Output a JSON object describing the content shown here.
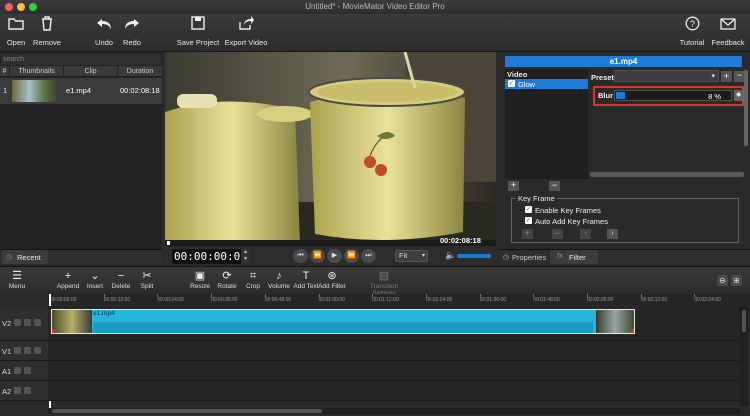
{
  "window": {
    "title": "Untitled* - MovieMator Video Editor Pro"
  },
  "toolbar": {
    "open": "Open",
    "remove": "Remove",
    "undo": "Undo",
    "redo": "Redo",
    "save_project": "Save Project",
    "export_video": "Export Video",
    "tutorial": "Tutorial",
    "feedback": "Feedback"
  },
  "media": {
    "search_placeholder": "search",
    "columns": [
      "#",
      "Thumbnails",
      "Clip",
      "Duration"
    ],
    "rows": [
      {
        "index": "1",
        "clip": "e1.mp4",
        "duration": "00:02:08:18"
      }
    ],
    "recent_tab": "Recent"
  },
  "player": {
    "timecode": "00:00:00:00",
    "duration": "00:02:08:18",
    "zoom": "Fit"
  },
  "filters": {
    "clip_name": "e1.mp4",
    "category": "Video",
    "filter_item": "Glow",
    "preset_label": "Preset",
    "blur_label": "Blur",
    "blur_value": "8 %",
    "blur_fraction": 0.08,
    "keyframe_title": "Key Frame",
    "enable_keyframes": "Enable Key Frames",
    "auto_add_keyframes": "Auto Add Key Frames",
    "properties_tab": "Properties",
    "filter_tab": "Filter",
    "accent": "#1e7bd6",
    "highlight": "#d9362b"
  },
  "timeline_toolbar": {
    "menu": "Menu",
    "append": "Append",
    "insert": "Insert",
    "delete": "Delete",
    "split": "Split",
    "resize": "Resize",
    "rotate": "Rotate",
    "crop": "Crop",
    "volume": "Volume",
    "add_text": "Add Text",
    "add_filter": "Add Filter",
    "transition_settings": "Transition Settings"
  },
  "timeline": {
    "ruler": [
      "00:00:00:00",
      "00:00:12:00",
      "00:00:24:00",
      "00:00:36:00",
      "00:00:48:00",
      "00:01:00:00",
      "00:01:12:00",
      "00:01:24:00",
      "00:01:36:00",
      "00:01:48:00",
      "00:02:00:00",
      "00:02:12:00",
      "00:02:24:00"
    ],
    "tracks": [
      "V2",
      "V1",
      "A1",
      "A2"
    ],
    "clip_label": "e1.mp4",
    "clip_color": "#25b4dc"
  }
}
